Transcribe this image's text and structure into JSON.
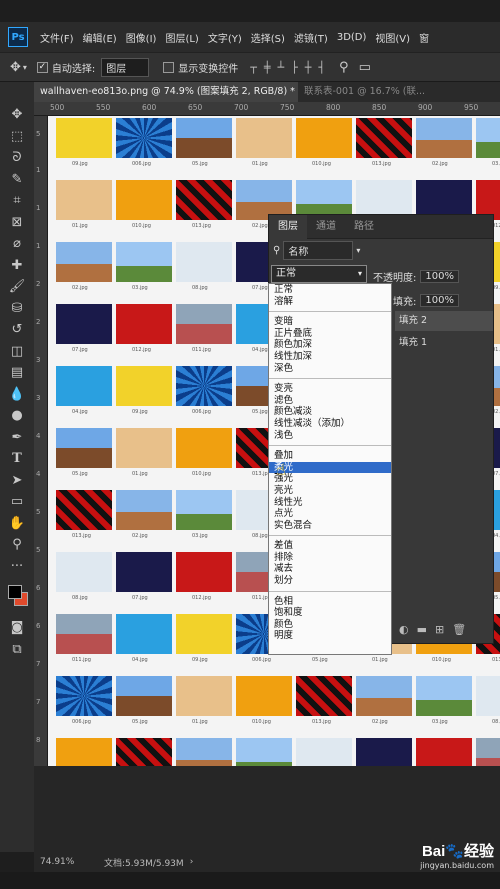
{
  "app": {
    "logo": "Ps"
  },
  "menu": [
    "文件(F)",
    "编辑(E)",
    "图像(I)",
    "图层(L)",
    "文字(Y)",
    "选择(S)",
    "滤镜(T)",
    "3D(D)",
    "视图(V)",
    "窗"
  ],
  "options_bar": {
    "auto_select_label": "自动选择:",
    "auto_select_value": "图层",
    "auto_select_checked": true,
    "show_transform_label": "显示变换控件"
  },
  "tabs": [
    {
      "label": "wallhaven-eo813o.png @ 74.9% (图案填充 2, RGB/8) *",
      "close": "×",
      "active": true
    },
    {
      "label": "联系表-001 @ 16.7% (联...",
      "active": false
    }
  ],
  "ruler_h": [
    "500",
    "550",
    "600",
    "650",
    "700",
    "750",
    "800",
    "850",
    "900",
    "950"
  ],
  "ruler_v": [
    "5",
    "1",
    "1",
    "1",
    "2",
    "2",
    "3",
    "3",
    "4",
    "4",
    "5",
    "5",
    "6",
    "6",
    "7",
    "7",
    "8"
  ],
  "layers_panel": {
    "tabs": [
      "图层",
      "通道",
      "路径"
    ],
    "filter_label": "名称",
    "blend_mode": "正常",
    "opacity_label": "不透明度:",
    "opacity_value": "100%",
    "fill_label": "填充:",
    "fill_value": "100%",
    "layers": [
      "填充 2",
      "填充 1"
    ]
  },
  "blend_groups": [
    [
      "正常",
      "溶解"
    ],
    [
      "变暗",
      "正片叠底",
      "颜色加深",
      "线性加深",
      "深色"
    ],
    [
      "变亮",
      "滤色",
      "颜色减淡",
      "线性减淡（添加）",
      "浅色"
    ],
    [
      "叠加",
      "柔光",
      "强光",
      "亮光",
      "线性光",
      "点光",
      "实色混合"
    ],
    [
      "差值",
      "排除",
      "减去",
      "划分"
    ],
    [
      "色相",
      "饱和度",
      "颜色",
      "明度"
    ]
  ],
  "selected_blend": "柔光",
  "status": {
    "zoom": "74.91%",
    "doc": "文档:5.93M/5.93M"
  },
  "watermark": {
    "brand": "Bai🐾经验",
    "url": "jingyan.baidu.com"
  },
  "thumb_captions": [
    "09.jpg",
    "006.jpg",
    "05.jpg",
    "01.jpg",
    "010.jpg",
    "013.jpg",
    "02.jpg",
    "03.jpg",
    "08.jpg",
    "07.jpg",
    "012.jpg",
    "011.jpg",
    "04.jpg"
  ],
  "colors": {
    "foreground": "#000000",
    "background": "#e04a2c",
    "selection": "#2f6bc9"
  }
}
